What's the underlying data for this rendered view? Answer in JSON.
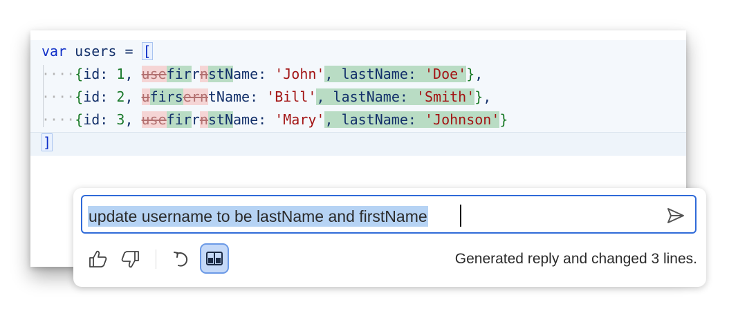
{
  "editor": {
    "line1": {
      "keyword": "var",
      "variable": "users",
      "equals": "=",
      "bracket_open": "["
    },
    "rows": [
      {
        "indent": "····",
        "open": "{",
        "id_key": "id:",
        "id_value": "1",
        "comma1": ",",
        "pre": [
          {
            "t": "use",
            "k": "del"
          },
          {
            "t": "fir",
            "k": "ins"
          },
          {
            "t": "r",
            "k": "plain"
          },
          {
            "t": "n",
            "k": "del"
          },
          {
            "t": "stN",
            "k": "ins"
          }
        ],
        "after": "ame:",
        "first_value": "'John'",
        "comma2": ",",
        "last_key": "lastName:",
        "last_value": "'Doe'",
        "close": "}",
        "trail": ","
      },
      {
        "indent": "····",
        "open": "{",
        "id_key": "id:",
        "id_value": "2",
        "comma1": ",",
        "pre": [
          {
            "t": "u",
            "k": "del"
          },
          {
            "t": "firs",
            "k": "ins"
          },
          {
            "t": "ern",
            "k": "del"
          },
          {
            "t": "tN",
            "k": "plain"
          }
        ],
        "after": "ame:",
        "first_value": "'Bill'",
        "comma2": ",",
        "last_key": "lastName:",
        "last_value": "'Smith'",
        "close": "}",
        "trail": ","
      },
      {
        "indent": "····",
        "open": "{",
        "id_key": "id:",
        "id_value": "3",
        "comma1": ",",
        "pre": [
          {
            "t": "use",
            "k": "del"
          },
          {
            "t": "fir",
            "k": "ins"
          },
          {
            "t": "r",
            "k": "plain"
          },
          {
            "t": "n",
            "k": "del"
          },
          {
            "t": "stN",
            "k": "ins"
          }
        ],
        "after": "ame:",
        "first_value": "'Mary'",
        "comma2": ",",
        "last_key": "lastName:",
        "last_value": "'Johnson'",
        "close": "}",
        "trail": ""
      }
    ],
    "line5": {
      "bracket_close": "]"
    }
  },
  "chat": {
    "prompt": "update username to be lastName and firstName",
    "status": "Generated reply and changed 3 lines."
  },
  "icons": {
    "send": "send-icon",
    "thumbs_up": "thumbs-up-icon",
    "thumbs_down": "thumbs-down-icon",
    "undo": "undo-icon",
    "diff": "diff-view-icon"
  },
  "colors": {
    "inserted": "#b9dcc4",
    "deleted": "#f5d5d5",
    "accent": "#2f6ad8",
    "selection": "#b6d3f4"
  }
}
